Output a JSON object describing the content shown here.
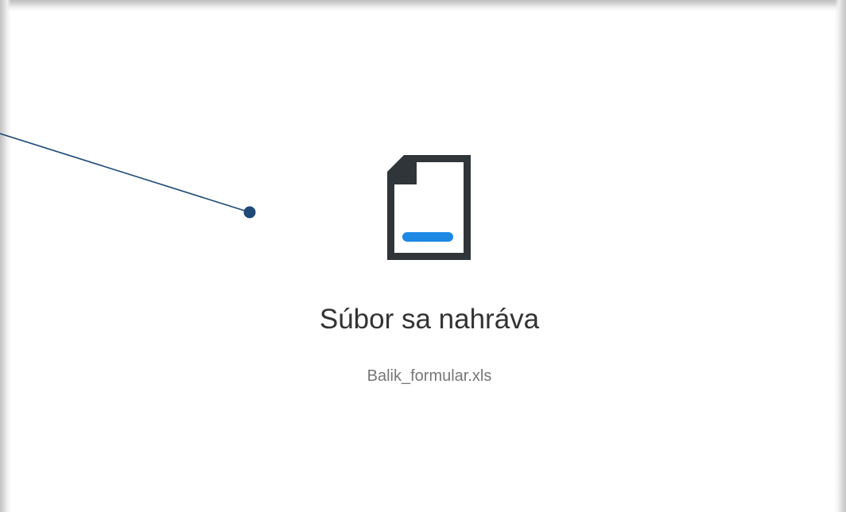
{
  "upload": {
    "title": "Súbor sa nahráva",
    "file_name": "Balik_formular.xls",
    "icon": "document-upload-icon"
  },
  "colors": {
    "icon_dark": "#2f3538",
    "progress_blue": "#1e88e5",
    "annotation_line": "#1f4a78",
    "title_text": "#333333",
    "filename_text": "#777777"
  }
}
